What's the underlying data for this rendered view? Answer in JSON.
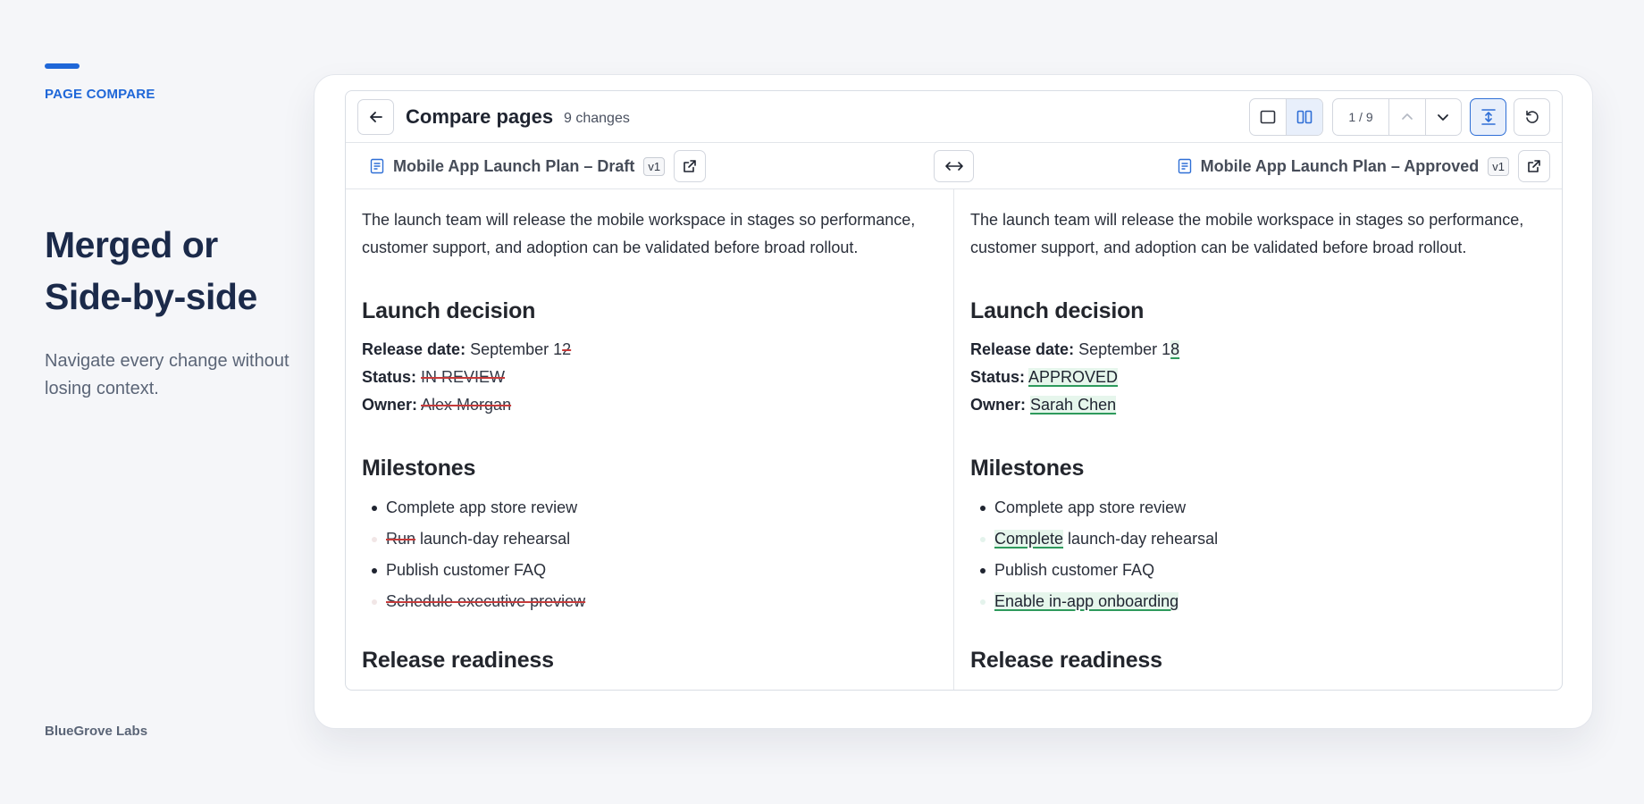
{
  "marketing": {
    "eyebrow": "PAGE COMPARE",
    "headline": "Merged or Side-by-side",
    "subline": "Navigate every change without losing context.",
    "brand": "BlueGrove Labs",
    "accent_color": "#1f67d8"
  },
  "toolbar": {
    "title": "Compare pages",
    "changes": "9 changes",
    "counter": "1 / 9",
    "icons": {
      "back": "arrow-left-icon",
      "single_view": "single-pane-icon",
      "split_view": "split-pane-icon",
      "prev": "chevron-up-icon",
      "next": "chevron-down-icon",
      "fit": "fit-height-icon",
      "reset": "reset-icon"
    },
    "active_view": "split"
  },
  "docs": {
    "left": {
      "name": "Mobile App Launch Plan – Draft",
      "version": "v1"
    },
    "right": {
      "name": "Mobile App Launch Plan – Approved",
      "version": "v1"
    },
    "swap_icon": "swap-horizontal-icon",
    "open_icon": "external-link-icon"
  },
  "left": {
    "intro": "The launch team will release the mobile workspace in stages so performance, customer support, and adoption can be validated before broad rollout.",
    "h_decision": "Launch decision",
    "release_label": "Release date:",
    "release_prefix": "September 1",
    "release_changed": "2",
    "status_label": "Status:",
    "status_value": "IN REVIEW",
    "owner_label": "Owner:",
    "owner_value": "Alex Morgan",
    "h_milestones": "Milestones",
    "m1": "Complete app store review",
    "m2_changed": "Run",
    "m2_rest": " launch-day rehearsal",
    "m3": "Publish customer FAQ",
    "m4_changed": "Schedule executive preview",
    "h_readiness": "Release readiness"
  },
  "right": {
    "intro": "The launch team will release the mobile workspace in stages so performance, customer support, and adoption can be validated before broad rollout.",
    "h_decision": "Launch decision",
    "release_label": "Release date:",
    "release_prefix": "September 1",
    "release_changed": "8",
    "status_label": "Status:",
    "status_value": "APPROVED",
    "owner_label": "Owner:",
    "owner_value": "Sarah Chen",
    "h_milestones": "Milestones",
    "m1": "Complete app store review",
    "m2_changed": "Complete",
    "m2_rest": " launch-day rehearsal",
    "m3": "Publish customer FAQ",
    "m4_changed": "Enable in-app onboarding",
    "h_readiness": "Release readiness"
  },
  "colors": {
    "deletion": "#c63b3b",
    "insertion_bg": "#e6f6ec",
    "insertion_line": "#2e9a5c",
    "active_bg": "#e8effb",
    "active_border": "#2f6fd6"
  }
}
